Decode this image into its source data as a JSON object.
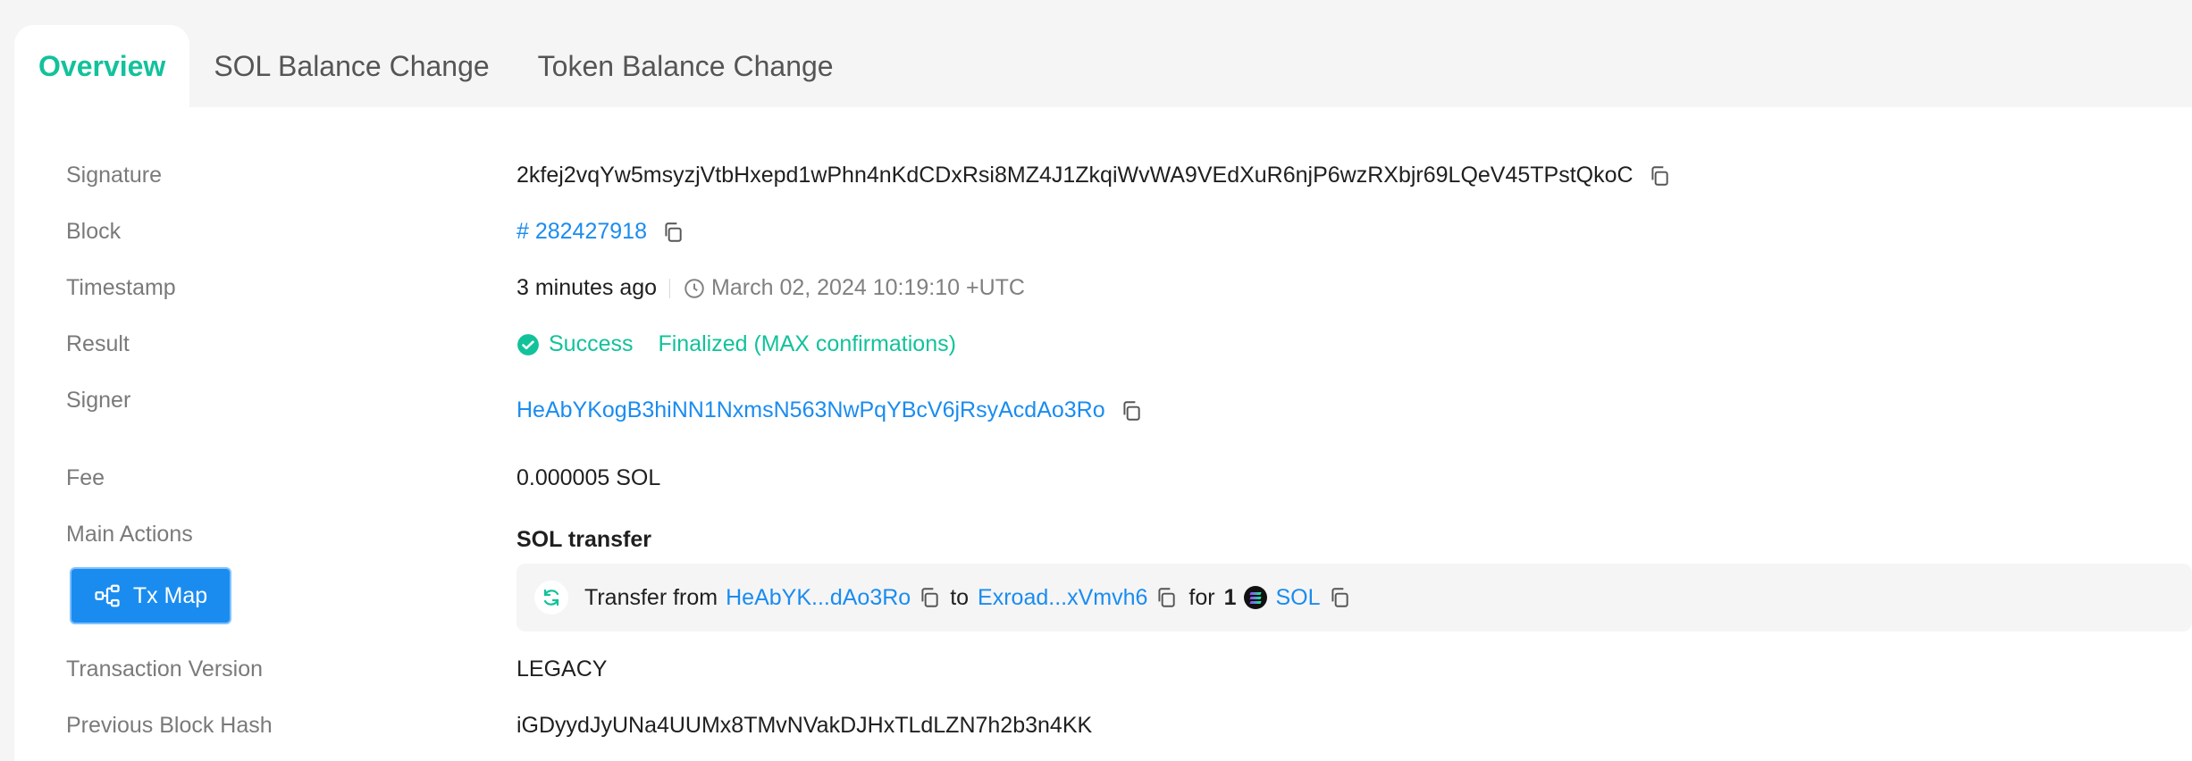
{
  "tabs": {
    "overview": "Overview",
    "sol_balance": "SOL Balance Change",
    "token_balance": "Token Balance Change"
  },
  "fields": {
    "signature": {
      "label": "Signature",
      "value": "2kfej2vqYw5msyzjVtbHxepd1wPhn4nKdCDxRsi8MZ4J1ZkqiWvWA9VEdXuR6njP6wzRXbjr69LQeV45TPstQkoC"
    },
    "block": {
      "label": "Block",
      "value": "# 282427918"
    },
    "timestamp": {
      "label": "Timestamp",
      "relative": "3 minutes ago",
      "absolute": "March 02, 2024 10:19:10 +UTC"
    },
    "result": {
      "label": "Result",
      "status": "Success",
      "confirmation": "Finalized (MAX confirmations)"
    },
    "signer": {
      "label": "Signer",
      "value": "HeAbYKogB3hiNN1NxmsN563NwPqYBcV6jRsyAcdAo3Ro"
    },
    "fee": {
      "label": "Fee",
      "value": "0.000005 SOL"
    },
    "main_actions": {
      "label": "Main Actions",
      "title": "SOL transfer",
      "tx_map_button": "Tx Map",
      "transfer": {
        "prefix": "Transfer from",
        "from": "HeAbYK...dAo3Ro",
        "to_word": "to",
        "to": "Exroad...xVmvh6",
        "for_word": "for",
        "amount": "1",
        "token": "SOL"
      }
    },
    "version": {
      "label": "Transaction Version",
      "value": "LEGACY"
    },
    "prev_hash": {
      "label": "Previous Block Hash",
      "value": "iGDyydJyUNa4UUMx8TMvNVakDJHxTLdLZN7h2b3n4KK"
    }
  },
  "colors": {
    "accent_green": "#12c29a",
    "link_blue": "#1a8cf0",
    "label_gray": "#7a7a7a"
  }
}
